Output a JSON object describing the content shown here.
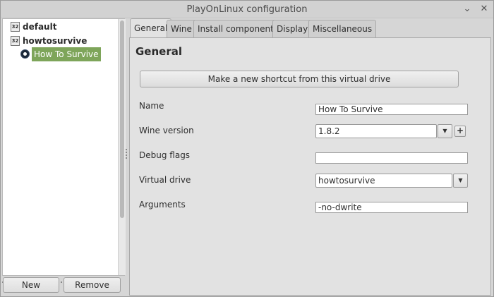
{
  "window": {
    "title": "PlayOnLinux configuration",
    "minimize_glyph": "⌄",
    "close_glyph": "✕"
  },
  "tree": {
    "items": [
      {
        "badge": "32",
        "label": "default"
      },
      {
        "badge": "32",
        "label": "howtosurvive"
      }
    ],
    "child": {
      "label": "How To Survive",
      "icon": "steam-icon"
    }
  },
  "left_buttons": {
    "new_label": "New",
    "remove_label": "Remove"
  },
  "tabs": [
    {
      "label": "General"
    },
    {
      "label": "Wine"
    },
    {
      "label": "Install components"
    },
    {
      "label": "Display"
    },
    {
      "label": "Miscellaneous"
    }
  ],
  "general": {
    "title": "General",
    "shortcut_button": "Make a new shortcut from this virtual drive",
    "fields": {
      "name": {
        "label": "Name",
        "value": "How To Survive"
      },
      "wine_version": {
        "label": "Wine version",
        "value": "1.8.2",
        "add_glyph": "+"
      },
      "debug_flags": {
        "label": "Debug flags",
        "value": ""
      },
      "virtual_drive": {
        "label": "Virtual drive",
        "value": "howtosurvive"
      },
      "arguments": {
        "label": "Arguments",
        "value": "-no-dwrite"
      }
    },
    "dropdown_glyph": "▼"
  },
  "colors": {
    "selection": "#7ea55a",
    "background": "#d6d6d6",
    "panel": "#e2e2e2"
  }
}
